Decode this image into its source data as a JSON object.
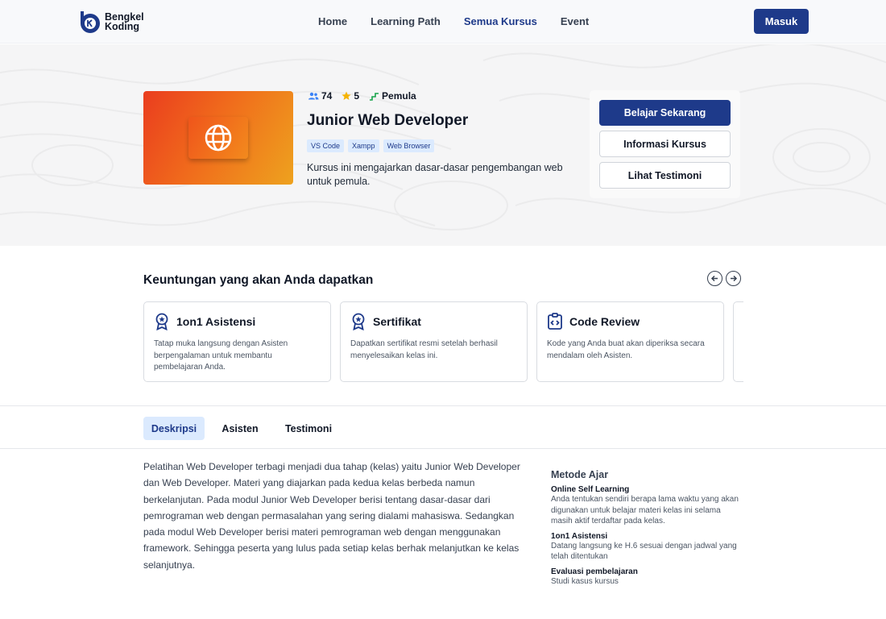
{
  "brand": {
    "line1": "Bengkel",
    "line2": "Koding"
  },
  "nav": {
    "items": [
      "Home",
      "Learning Path",
      "Semua Kursus",
      "Event"
    ],
    "active_index": 2,
    "login_label": "Masuk"
  },
  "course": {
    "participants": "74",
    "rating": "5",
    "level": "Pemula",
    "title": "Junior Web Developer",
    "tags": [
      "VS Code",
      "Xampp",
      "Web Browser"
    ],
    "description": "Kursus ini mengajarkan dasar-dasar pengembangan web untuk pemula."
  },
  "cta": {
    "primary": "Belajar Sekarang",
    "info": "Informasi Kursus",
    "testimony": "Lihat Testimoni"
  },
  "benefits": {
    "title": "Keuntungan yang akan Anda dapatkan",
    "items": [
      {
        "icon": "award-icon",
        "title": "1on1 Asistensi",
        "text": "Tatap muka langsung dengan Asisten berpengalaman untuk membantu pembelajaran Anda."
      },
      {
        "icon": "certificate-icon",
        "title": "Sertifikat",
        "text": "Dapatkan sertifikat resmi setelah berhasil menyelesaikan kelas ini."
      },
      {
        "icon": "code-review-icon",
        "title": "Code Review",
        "text": "Kode yang Anda buat akan diperiksa secara mendalam oleh Asisten."
      }
    ]
  },
  "tabs": {
    "items": [
      "Deskripsi",
      "Asisten",
      "Testimoni"
    ],
    "active_index": 0
  },
  "description": "Pelatihan Web Developer terbagi menjadi dua tahap (kelas) yaitu Junior Web Developer dan Web Developer. Materi yang diajarkan pada kedua kelas berbeda namun berkelanjutan. Pada modul Junior Web Developer berisi tentang dasar-dasar dari pemrograman web dengan permasalahan yang sering dialami mahasiswa. Sedangkan pada modul Web Developer berisi materi pemrograman web dengan menggunakan framework. Sehingga peserta yang lulus pada setiap kelas berhak melanjutkan ke kelas selanjutnya.",
  "method": {
    "title": "Metode Ajar",
    "items": [
      {
        "title": "Online Self Learning",
        "text": "Anda tentukan sendiri berapa lama waktu yang akan digunakan untuk belajar materi kelas ini selama masih aktif terdaftar pada kelas."
      },
      {
        "title": "1on1 Asistensi",
        "text": "Datang langsung ke H.6 sesuai dengan jadwal yang telah ditentukan"
      },
      {
        "title": "Evaluasi pembelajaran",
        "text": "Studi kasus kursus"
      }
    ]
  },
  "colors": {
    "primary": "#1e3a8a",
    "accent_orange": "#f06b1c",
    "tag_bg": "#dbeafe",
    "star": "#f5b301",
    "level_green": "#16a34a"
  }
}
